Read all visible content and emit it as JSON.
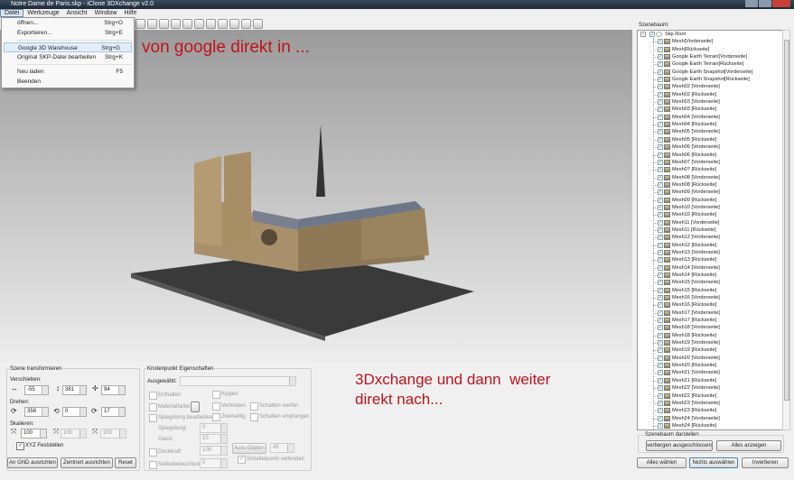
{
  "window": {
    "title": "Notre Dame de Paris.skp - iClone 3DXchange v2.0"
  },
  "menubar": [
    "Datei",
    "Werkzeuge",
    "Ansicht",
    "Window",
    "Hilfe"
  ],
  "file_menu": [
    {
      "label": "öffnen...",
      "shortcut": "Strg+O"
    },
    {
      "label": "Exportieren...",
      "shortcut": "Strg+E"
    },
    {
      "label": "Google 3D Warehouse",
      "shortcut": "Strg+G"
    },
    {
      "label": "Original SKP-Datei bearbeiten",
      "shortcut": "Strg+K"
    },
    {
      "label": "Neu laden",
      "shortcut": "F5"
    },
    {
      "label": "Beenden",
      "shortcut": ""
    }
  ],
  "annotations": {
    "top": "von google direkt in ...",
    "bottom": "3Dxchange und dann  weiter\ndirekt nach..."
  },
  "transform": {
    "title": "Szene transformieren",
    "move_label": "Verschieben:",
    "move": [
      "-55",
      "381",
      "94"
    ],
    "rotate_label": "Drehen:",
    "rotate": [
      "358",
      "0",
      "17"
    ],
    "scale_label": "Skalieren:",
    "scale": [
      "100",
      "100",
      "100"
    ],
    "lock_label": "XYZ Feststellen",
    "btn_gnd": "An GND ausrichten",
    "btn_center": "Zentriert ausrichten",
    "btn_reset": "Reset"
  },
  "node": {
    "title": "Knotenpunkt Eigenschaften",
    "selected_label": "Ausgewählt:",
    "contain": "Enthalten",
    "material": "Materialfarbe",
    "reflection_edit": "Spiegelung bearbeiten",
    "reflection": "Spiegelung:",
    "reflection_val": "0",
    "gloss": "Glanz:",
    "gloss_val": "10",
    "opacity": "Deckkraft",
    "opacity_val": "100",
    "selfillum": "Selbstbeleuchtung",
    "selfillum_val": "0",
    "tilt": "Kippen",
    "connect": "Verbinden",
    "twosided": "Zweiseitig",
    "cast_shadow": "Schatten werfen",
    "receive_shadow": "Schatten empfangen",
    "autosmooth": "Auto-Glätten",
    "autosmooth_val": "45",
    "vertex": "Scheitelpunkt verbinden"
  },
  "scenetree": {
    "title": "Szenebaum:",
    "root": "Skp Root",
    "items": [
      "Mesh[Vorderseite]",
      "Mesh[Rückseite]",
      "Google Earth Terrain[Vorderseite]",
      "Google Earth Terrain[Rückseite]",
      "Google Earth Snapshot[Vorderseite]",
      "Google Earth Snapshot[Rückseite]",
      "Mesh02 [Vorderseite]",
      "Mesh02 [Rückseite]",
      "Mesh03 [Vorderseite]",
      "Mesh03 [Rückseite]",
      "Mesh04 [Vorderseite]",
      "Mesh04 [Rückseite]",
      "Mesh05 [Vorderseite]",
      "Mesh05 [Rückseite]",
      "Mesh06 [Vorderseite]",
      "Mesh06 [Rückseite]",
      "Mesh07 [Vorderseite]",
      "Mesh07 [Rückseite]",
      "Mesh08 [Vorderseite]",
      "Mesh08 [Rückseite]",
      "Mesh09 [Vorderseite]",
      "Mesh09 [Rückseite]",
      "Mesh10 [Vorderseite]",
      "Mesh10 [Rückseite]",
      "Mesh11 [Vorderseite]",
      "Mesh11 [Rückseite]",
      "Mesh12 [Vorderseite]",
      "Mesh12 [Rückseite]",
      "Mesh13 [Vorderseite]",
      "Mesh13 [Rückseite]",
      "Mesh14 [Vorderseite]",
      "Mesh14 [Rückseite]",
      "Mesh15 [Vorderseite]",
      "Mesh15 [Rückseite]",
      "Mesh16 [Vorderseite]",
      "Mesh16 [Rückseite]",
      "Mesh17 [Vorderseite]",
      "Mesh17 [Rückseite]",
      "Mesh18 [Vorderseite]",
      "Mesh18 [Rückseite]",
      "Mesh19 [Vorderseite]",
      "Mesh19 [Rückseite]",
      "Mesh20 [Vorderseite]",
      "Mesh20 [Rückseite]",
      "Mesh21 [Vorderseite]",
      "Mesh21 [Rückseite]",
      "Mesh22 [Vorderseite]",
      "Mesh22 [Rückseite]",
      "Mesh23 [Vorderseite]",
      "Mesh23 [Rückseite]",
      "Mesh24 [Vorderseite]",
      "Mesh24 [Rückseite]"
    ],
    "display_title": "Szenebaum darstellen",
    "btn_hide": "verbergen ausgeschlossen",
    "btn_show_all": "Alles anzeigen",
    "btn_select_all": "Alles wählen",
    "btn_select_none": "Nichts auswählen",
    "btn_invert": "Invertieren"
  }
}
